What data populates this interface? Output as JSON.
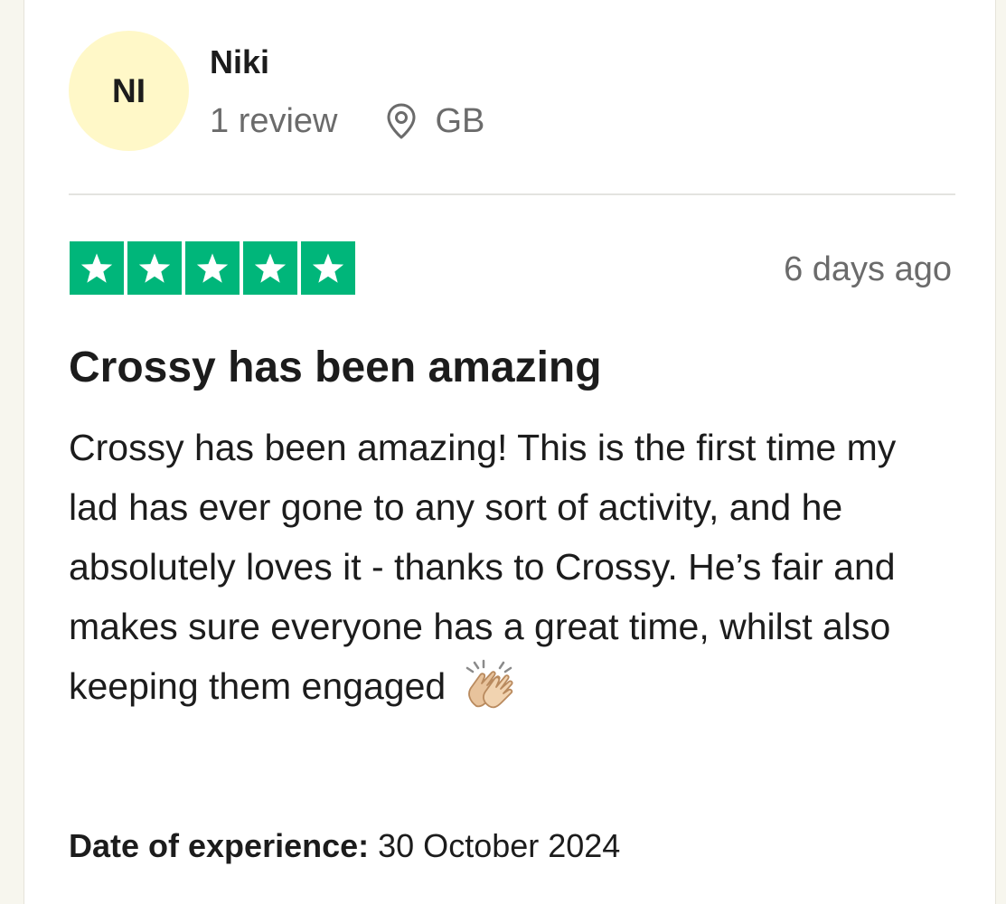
{
  "reviewer": {
    "initials": "NI",
    "name": "Niki",
    "review_count": "1 review",
    "country": "GB"
  },
  "rating": {
    "stars": 5,
    "max_stars": 5,
    "color": "#00b67a"
  },
  "posted_ago": "6 days ago",
  "review": {
    "title": "Crossy has been amazing",
    "body": "Crossy has been amazing! This is the first time my lad has ever gone to any sort of activity, and he absolutely loves it - thanks to Crossy. He’s fair and makes sure everyone has a great time, whilst also keeping them engaged",
    "emoji": "clapping-hands-icon"
  },
  "experience": {
    "label": "Date of experience:",
    "date": "30 October 2024"
  },
  "colors": {
    "avatar_bg": "#fff8c8",
    "muted_text": "#6b6b6b",
    "star_green": "#00b67a"
  }
}
